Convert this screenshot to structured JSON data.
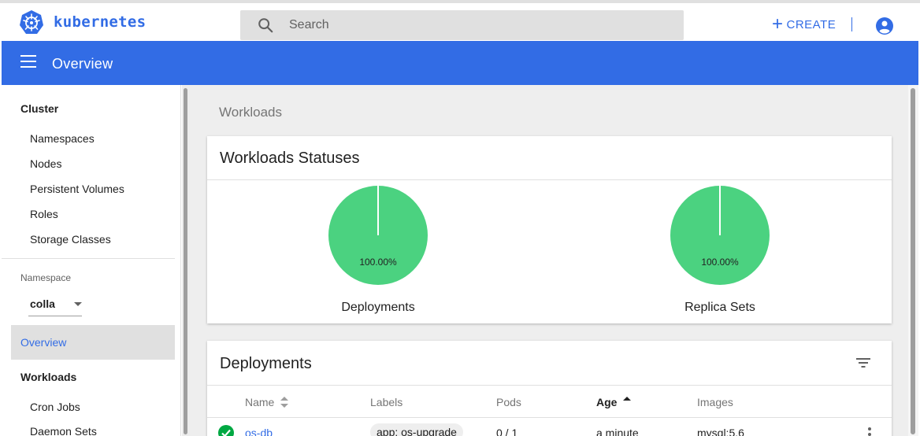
{
  "header": {
    "brand": "kubernetes",
    "search_placeholder": "Search",
    "create_label": "CREATE"
  },
  "toolbar": {
    "title": "Overview"
  },
  "sidebar": {
    "cluster_title": "Cluster",
    "cluster_items": [
      "Namespaces",
      "Nodes",
      "Persistent Volumes",
      "Roles",
      "Storage Classes"
    ],
    "namespace_label": "Namespace",
    "namespace_value": "colla",
    "active_item": "Overview",
    "workloads_title": "Workloads",
    "workloads_items": [
      "Cron Jobs",
      "Daemon Sets"
    ]
  },
  "main": {
    "breadcrumb": "Workloads",
    "statuses_card": {
      "title": "Workloads Statuses",
      "charts": [
        {
          "caption": "Deployments",
          "percent_label": "100.00%",
          "running_fraction": 1.0
        },
        {
          "caption": "Replica Sets",
          "percent_label": "100.00%",
          "running_fraction": 1.0
        }
      ]
    },
    "deployments_card": {
      "title": "Deployments",
      "columns": [
        "Name",
        "Labels",
        "Pods",
        "Age",
        "Images"
      ],
      "rows": [
        {
          "name": "os-db",
          "label": "app: os-upgrade",
          "pods": "0 / 1",
          "age": "a minute",
          "images": "mysql:5.6"
        }
      ]
    }
  },
  "colors": {
    "primary": "#326ce5",
    "pie_running": "#4bd280",
    "ok": "#00a842"
  }
}
